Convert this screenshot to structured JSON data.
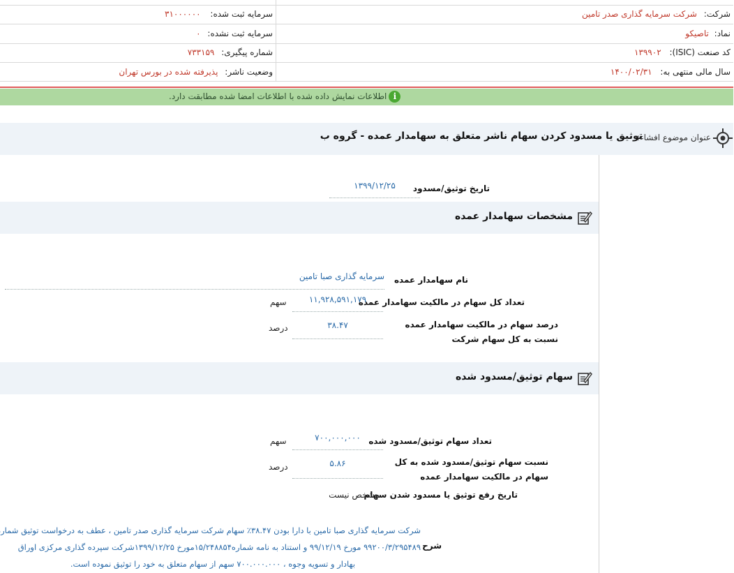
{
  "header": {
    "company_label": "شرکت:",
    "company_value": "شرکت سرمایه گذاری صدر تامین",
    "registered_capital_label": "سرمایه ثبت شده:",
    "registered_capital_value": "۳۱۰۰۰۰۰۰",
    "symbol_label": "نماد:",
    "symbol_value": "تاصیکو",
    "unregistered_capital_label": "سرمایه ثبت نشده:",
    "unregistered_capital_value": "۰",
    "isic_label": "کد صنعت (ISIC):",
    "isic_value": "۱۳۹۹۰۲",
    "tracking_label": "شماره پیگیری:",
    "tracking_value": "۷۳۳۱۵۹",
    "fiscal_year_label": "سال مالی منتهی به:",
    "fiscal_year_value": "۱۴۰۰/۰۲/۳۱",
    "publisher_status_label": "وضعیت ناشر:",
    "publisher_status_value": "پذیرفته شده در بورس تهران"
  },
  "notice": {
    "icon": "info-icon",
    "text": "اطلاعات نمایش داده شده با اطلاعات امضا شده مطابقت دارد.",
    "color": "#aed8a0"
  },
  "subject": {
    "label": "عنوان موضوع افشاء:",
    "value": "توثیق یا مسدود کردن سهام ناشر متعلق به سهامدار عمده - گروه ب"
  },
  "pledge_date": {
    "label": "تاریخ توثیق/مسدود",
    "value": "۱۳۹۹/۱۲/۲۵"
  },
  "shareholder_section": {
    "title": "مشخصات سهامدار عمده",
    "name_label": "نام سهامدار عمده",
    "name_value": "سرمایه گذاری صبا تامین",
    "total_shares_label": "تعداد کل سهام در مالکیت سهامدار عمده",
    "total_shares_value": "۱۱,۹۲۸,۵۹۱,۱۷۹",
    "total_shares_unit": "سهم",
    "percent_label": "درصد سهام در مالکیت سهامدار عمده نسبت به کل سهام شرکت",
    "percent_value": "۳۸.۴۷",
    "percent_unit": "درصد"
  },
  "pledged_section": {
    "title": "سهام توثیق/مسدود شده",
    "count_label": "تعداد سهام توثیق/مسدود شده",
    "count_value": "۷۰۰,۰۰۰,۰۰۰",
    "count_unit": "سهم",
    "ratio_label": "نسبت سهام توثیق/مسدود شده به کل سهام در مالکیت سهامدار عمده",
    "ratio_value": "۵.۸۶",
    "ratio_unit": "درصد",
    "release_label": "تاریخ رفع توثیق یا مسدود شدن سهام",
    "release_value": "مشخص نیست"
  },
  "description": {
    "label": "شرح",
    "line1": "شرکت سرمایه گذاری صبا تامین با دارا بودن ۳۸.۴۷٪ سهام شرکت سرمایه گذاری صدر تامین ، عطف به درخواست توثیق شماره",
    "line2": "۹۹۲۰۰/۳/۲۹۵۴۸۹ مورخ ۹۹/۱۲/۱۹ و استناد به نامه شماره۱۵/۲۴۸۸۵۴مورخ ۱۳۹۹/۱۲/۲۵شرکت سپرده گذاری مرکزی اوراق",
    "line3": "بهادار و تسویه وجوه ، ۷۰۰.۰۰۰.۰۰۰ سهم از سهام متعلق به خود را توثیق نموده است."
  }
}
